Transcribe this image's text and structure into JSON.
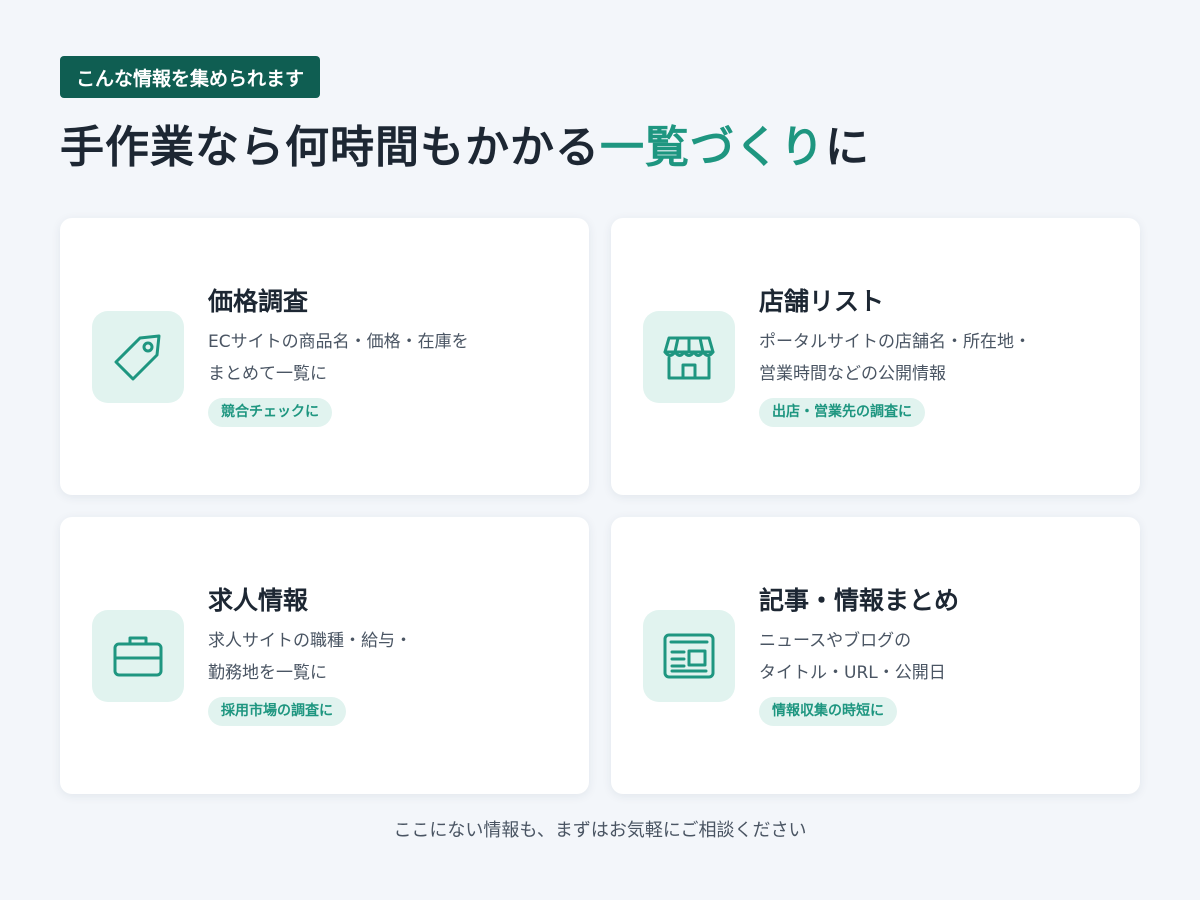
{
  "badge": "こんな情報を集められます",
  "title": {
    "before": "手作業なら何時間もかかる",
    "accent": "一覧づくり",
    "after": "に"
  },
  "colors": {
    "accent": "#1e9680",
    "badge_bg": "#0f5e52",
    "icon_bg": "#e1f3ef",
    "page_bg": "#f3f6fa"
  },
  "cards": [
    {
      "icon": "price-tag-icon",
      "title": "価格調査",
      "desc_lines": [
        "ECサイトの商品名・価格・在庫を",
        "まとめて一覧に"
      ],
      "tag": "競合チェックに"
    },
    {
      "icon": "storefront-icon",
      "title": "店舗リスト",
      "desc_lines": [
        "ポータルサイトの店舗名・所在地・",
        "営業時間などの公開情報"
      ],
      "tag": "出店・営業先の調査に"
    },
    {
      "icon": "briefcase-icon",
      "title": "求人情報",
      "desc_lines": [
        "求人サイトの職種・給与・",
        "勤務地を一覧に"
      ],
      "tag": "採用市場の調査に"
    },
    {
      "icon": "newspaper-icon",
      "title": "記事・情報まとめ",
      "desc_lines": [
        "ニュースやブログの",
        "タイトル・URL・公開日"
      ],
      "tag": "情報収集の時短に"
    }
  ],
  "footer": "ここにない情報も、まずはお気軽にご相談ください"
}
